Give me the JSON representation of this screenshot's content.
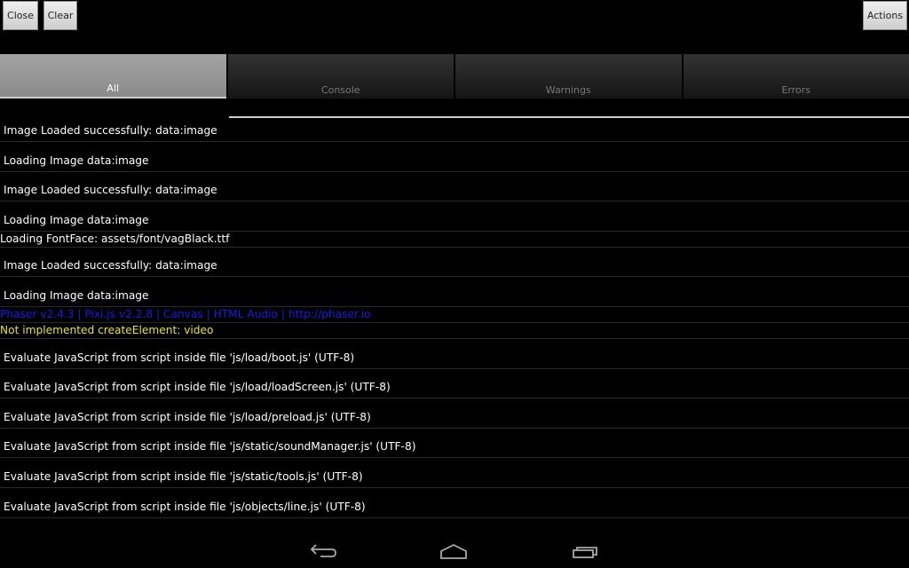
{
  "toolbar": {
    "close_label": "Close",
    "clear_label": "Clear",
    "actions_label": "Actions"
  },
  "tabs": [
    {
      "label": "All",
      "active": true
    },
    {
      "label": "Console"
    },
    {
      "label": "Warnings"
    },
    {
      "label": "Errors"
    }
  ],
  "colors": {
    "info": "#ffffff",
    "link": "#1a1ae6",
    "warning": "#e6e61a"
  },
  "log": [
    {
      "text": "Image Loaded successfully: data:image",
      "level": "info"
    },
    {
      "text": "Loading Image data:image",
      "level": "info"
    },
    {
      "text": "Image Loaded successfully: data:image",
      "level": "info"
    },
    {
      "text": "Loading Image data:image",
      "level": "info"
    },
    {
      "text": "Loading FontFace: assets/font/vagBlack.ttf",
      "level": "plain"
    },
    {
      "text": "Image Loaded successfully: data:image",
      "level": "info"
    },
    {
      "text": "Loading Image data:image",
      "level": "info"
    },
    {
      "text": "Phaser v2.4.3 | Pixi.js v2.2.8 | Canvas | HTML Audio | http://phaser.io",
      "level": "blue"
    },
    {
      "text": "Not implemented createElement: video",
      "level": "warning"
    },
    {
      "text": "Evaluate JavaScript from script inside file 'js/load/boot.js' (UTF-8)",
      "level": "info"
    },
    {
      "text": "Evaluate JavaScript from script inside file 'js/load/loadScreen.js' (UTF-8)",
      "level": "info"
    },
    {
      "text": "Evaluate JavaScript from script inside file 'js/load/preload.js' (UTF-8)",
      "level": "info"
    },
    {
      "text": "Evaluate JavaScript from script inside file 'js/static/soundManager.js' (UTF-8)",
      "level": "info"
    },
    {
      "text": "Evaluate JavaScript from script inside file 'js/static/tools.js' (UTF-8)",
      "level": "info"
    },
    {
      "text": "Evaluate JavaScript from script inside file 'js/objects/line.js' (UTF-8)",
      "level": "info"
    }
  ],
  "nav": {
    "icons": [
      "back-icon",
      "home-icon",
      "recent-apps-icon"
    ]
  }
}
